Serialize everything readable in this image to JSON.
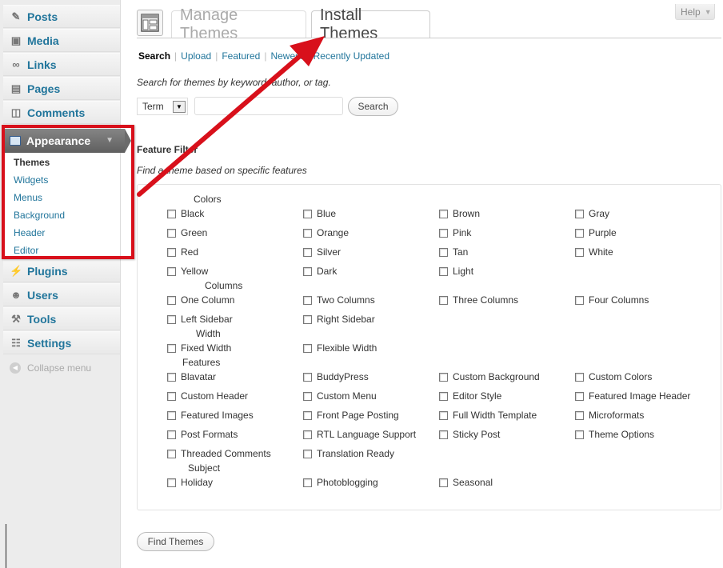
{
  "sidebar": {
    "items_top": [
      {
        "label": "Posts",
        "icon": "pin-icon",
        "glyph": "✎"
      },
      {
        "label": "Media",
        "icon": "media-icon",
        "glyph": "▣"
      },
      {
        "label": "Links",
        "icon": "link-icon",
        "glyph": "∞"
      },
      {
        "label": "Pages",
        "icon": "page-icon",
        "glyph": "▤"
      },
      {
        "label": "Comments",
        "icon": "comment-icon",
        "glyph": "◫"
      }
    ],
    "appearance": {
      "label": "Appearance",
      "icon": "appearance-icon"
    },
    "submenu": [
      "Themes",
      "Widgets",
      "Menus",
      "Background",
      "Header",
      "Editor"
    ],
    "items_bottom": [
      {
        "label": "Plugins",
        "icon": "plug-icon",
        "glyph": "⚡"
      },
      {
        "label": "Users",
        "icon": "users-icon",
        "glyph": "☻"
      },
      {
        "label": "Tools",
        "icon": "tools-icon",
        "glyph": "⚒"
      },
      {
        "label": "Settings",
        "icon": "settings-icon",
        "glyph": "☷"
      }
    ],
    "collapse_label": "Collapse menu"
  },
  "tabs": {
    "manage": "Manage Themes",
    "install": "Install Themes"
  },
  "help_label": "Help",
  "subnav": {
    "current": "Search",
    "links": [
      "Upload",
      "Featured",
      "Newest",
      "Recently Updated"
    ]
  },
  "search": {
    "description": "Search for themes by keyword, author, or tag.",
    "select_value": "Term",
    "input_value": "",
    "button_label": "Search"
  },
  "feature_filter": {
    "title": "Feature Filter",
    "description": "Find a theme based on specific features",
    "groups": [
      {
        "name": "Colors",
        "options": [
          "Black",
          "Blue",
          "Brown",
          "Gray",
          "Green",
          "Orange",
          "Pink",
          "Purple",
          "Red",
          "Silver",
          "Tan",
          "White",
          "Yellow",
          "Dark",
          "Light"
        ]
      },
      {
        "name": "Columns",
        "options": [
          "One Column",
          "Two Columns",
          "Three Columns",
          "Four Columns",
          "Left Sidebar",
          "Right Sidebar"
        ]
      },
      {
        "name": "Width",
        "options": [
          "Fixed Width",
          "Flexible Width"
        ]
      },
      {
        "name": "Features",
        "options": [
          "Blavatar",
          "BuddyPress",
          "Custom Background",
          "Custom Colors",
          "Custom Header",
          "Custom Menu",
          "Editor Style",
          "Featured Image Header",
          "Featured Images",
          "Front Page Posting",
          "Full Width Template",
          "Microformats",
          "Post Formats",
          "RTL Language Support",
          "Sticky Post",
          "Theme Options",
          "Threaded Comments",
          "Translation Ready"
        ]
      },
      {
        "name": "Subject",
        "options": [
          "Holiday",
          "Photoblogging",
          "Seasonal"
        ]
      }
    ],
    "find_button": "Find Themes"
  },
  "colors": {
    "link": "#21759b",
    "annotation_red": "#d8101b"
  }
}
